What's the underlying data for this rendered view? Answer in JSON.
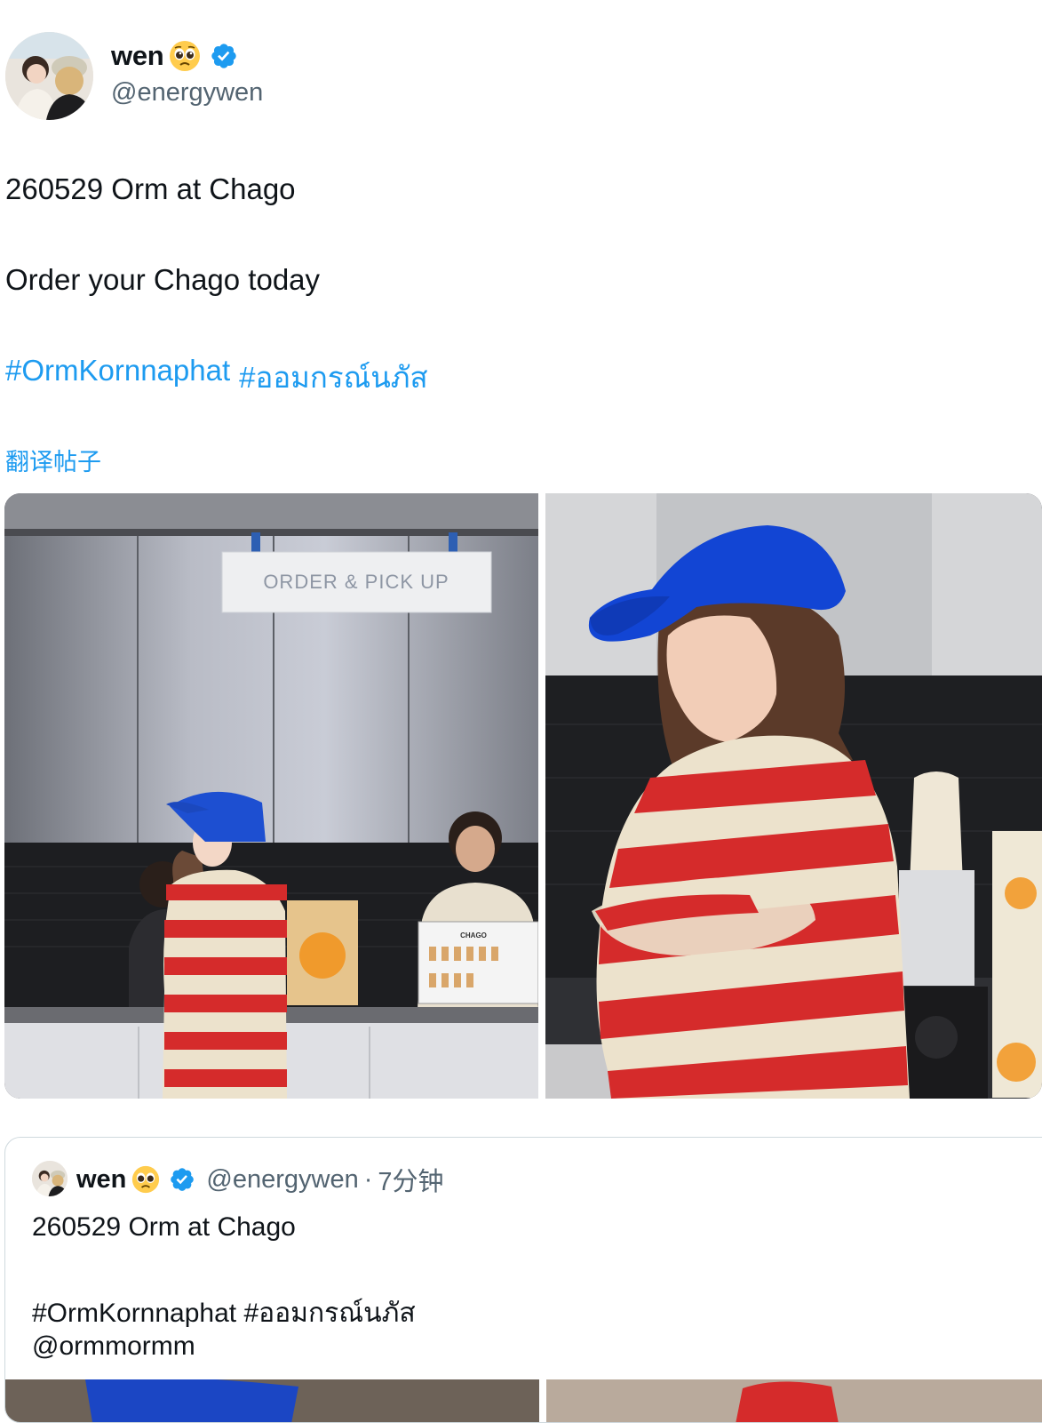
{
  "post": {
    "author_name": "wen",
    "author_handle": "@energywen",
    "line1": "260529 Orm at Chago",
    "line2": "Order your Chago today",
    "hashtags": [
      "#OrmKornnaphat",
      "#ออมกรณ์นภัส"
    ],
    "translate_label": "翻译帖子",
    "photo1_sign": "ORDER & PICK UP",
    "photo1_menu_brand": "CHAGO"
  },
  "quoted": {
    "author_name": "wen",
    "author_handle": "@energywen",
    "separator": "·",
    "time_ago": "7分钟",
    "line1": "260529 Orm at Chago",
    "hashtags": "#OrmKornnaphat #ออมกรณ์นภัส",
    "mention": "@ormmormm"
  },
  "colors": {
    "link_blue": "#1d9bf0",
    "text_primary": "#0f1419",
    "text_secondary": "#536471",
    "verified_blue": "#1d9bf0",
    "border": "#cfd9de"
  },
  "icons": {
    "emoji": "pleading-face-emoji",
    "verified": "verified-badge-icon"
  }
}
